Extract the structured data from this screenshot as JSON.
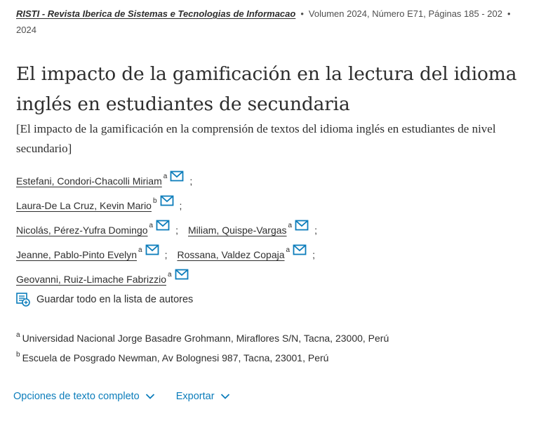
{
  "source": {
    "journal": "RISTI - Revista Iberica de Sistemas e Tecnologias de Informacao",
    "details": "Volumen 2024, Número E71, Páginas 185 - 202",
    "year": "2024"
  },
  "title": "El impacto de la gamificación en la lectura del idioma inglés en estudiantes de secundaria",
  "subtitle": "[El impacto de la gamificación en la comprensión de textos del idioma inglés en estudiantes de nivel secundario]",
  "authors": [
    {
      "name": "Estefani, Condori-Chacolli Miriam",
      "aff": "a"
    },
    {
      "name": "Laura-De La Cruz, Kevin Mario",
      "aff": "b"
    },
    {
      "name": "Nicolás, Pérez-Yufra Domingo",
      "aff": "a"
    },
    {
      "name": "Miliam, Quispe-Vargas",
      "aff": "a"
    },
    {
      "name": "Jeanne, Pablo-Pinto Evelyn",
      "aff": "a"
    },
    {
      "name": "Rossana, Valdez Copaja",
      "aff": "a"
    },
    {
      "name": "Geovanni, Ruiz-Limache Fabrizzio",
      "aff": "a"
    }
  ],
  "separator": ";",
  "save_all_label": "Guardar todo en la lista de autores",
  "affiliations": [
    {
      "key": "a",
      "text": "Universidad Nacional Jorge Basadre Grohmann, Miraflores S/N, Tacna, 23000, Perú"
    },
    {
      "key": "b",
      "text": "Escuela de Posgrado Newman, Av Bolognesi 987, Tacna, 23001, Perú"
    }
  ],
  "options": {
    "full_text_label": "Opciones de texto completo",
    "export_label": "Exportar"
  },
  "icons": {
    "mail": "envelope-icon",
    "save_list": "list-add-icon",
    "chevron": "chevron-down-icon"
  },
  "colors": {
    "text": "#2e2e2e",
    "link_blue": "#0c7dbb",
    "mail_icon": "#0c7dbb"
  }
}
